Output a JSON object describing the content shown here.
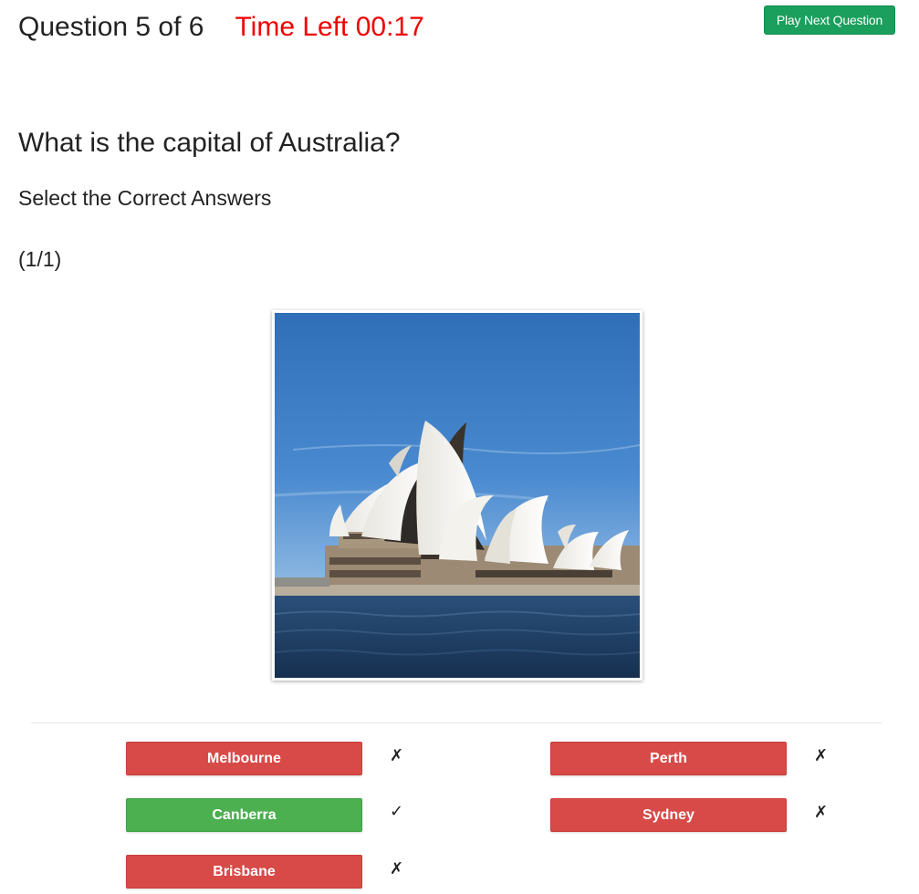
{
  "header": {
    "question_counter": "Question 5 of 6",
    "timer": "Time Left 00:17",
    "timer_color": "#ee0000",
    "next_button_label": "Play Next Question",
    "next_button_color": "#1a9f5c"
  },
  "question": {
    "text": "What is the capital of Australia?",
    "instruction": "Select the Correct Answers",
    "answer_count": "(1/1)",
    "image_subject": "sydney-opera-house"
  },
  "options": [
    {
      "label": "Melbourne",
      "status": "incorrect",
      "mark": "✗"
    },
    {
      "label": "Perth",
      "status": "incorrect",
      "mark": "✗"
    },
    {
      "label": "Canberra",
      "status": "correct",
      "mark": "✓"
    },
    {
      "label": "Sydney",
      "status": "incorrect",
      "mark": "✗"
    },
    {
      "label": "Brisbane",
      "status": "incorrect",
      "mark": "✗"
    }
  ],
  "colors": {
    "incorrect": "#d74a48",
    "correct": "#4caf50"
  }
}
